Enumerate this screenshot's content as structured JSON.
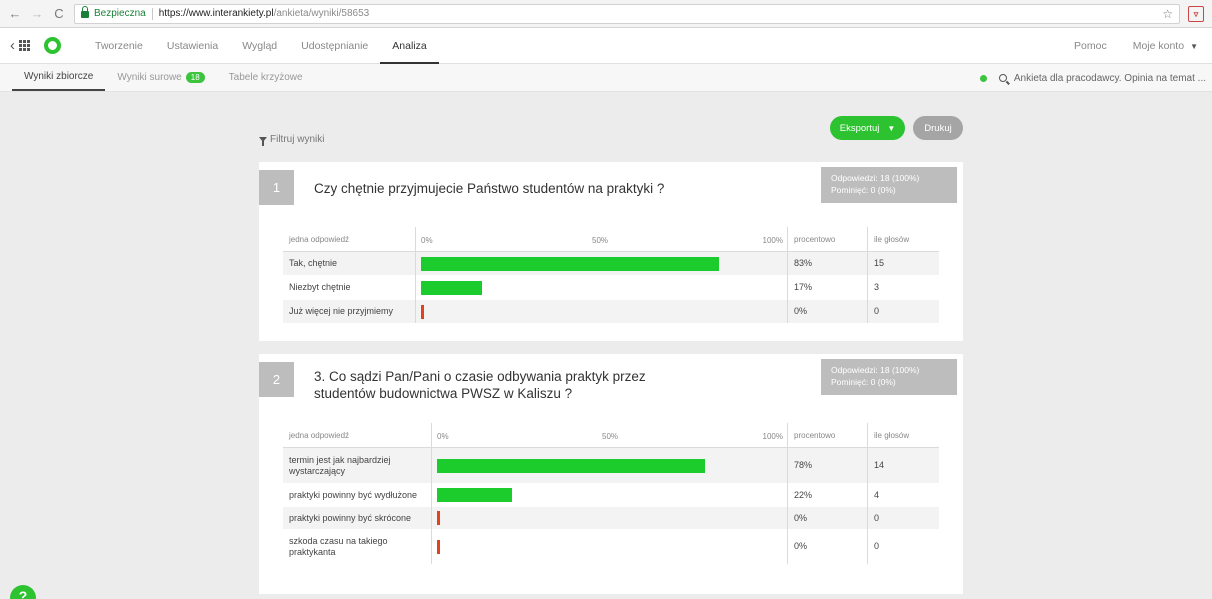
{
  "browser": {
    "secure_label": "Bezpieczna",
    "url_scheme_host": "https://www.interankiety.pl",
    "url_path": "/ankieta/wyniki/58653"
  },
  "app": {
    "tabs": [
      {
        "label": "Tworzenie"
      },
      {
        "label": "Ustawienia"
      },
      {
        "label": "Wygląd"
      },
      {
        "label": "Udostępnianie"
      },
      {
        "label": "Analiza"
      }
    ],
    "help_label": "Pomoc",
    "account_label": "Moje konto"
  },
  "subnav": {
    "tabs": [
      {
        "label": "Wyniki zbiorcze"
      },
      {
        "label": "Wyniki surowe",
        "badge": "18"
      },
      {
        "label": "Tabele krzyżowe"
      }
    ],
    "survey_name": "Ankieta dla pracodawcy. Opinia na temat ..."
  },
  "toolbar": {
    "filter_label": "Filtruj wyniki",
    "export_label": "Eksportuj",
    "print_label": "Drukuj"
  },
  "questions": [
    {
      "number": "1",
      "title_lines": [
        "Czy chętnie przyjmujecie Państwo studentów na praktyki ?"
      ],
      "answers_stat": "Odpowiedzi: 18 (100%)",
      "skipped_stat": "Pominięć: 0 (0%)",
      "headers": {
        "answer": "jedna odpowiedź",
        "scale0": "0%",
        "scale50": "50%",
        "scale100": "100%",
        "percent": "procentowo",
        "count": "ile głosów"
      },
      "rows": [
        {
          "label": "Tak, chętnie",
          "percent_text": "83%",
          "value": 83,
          "count": "15"
        },
        {
          "label": "Niezbyt chętnie",
          "percent_text": "17%",
          "value": 17,
          "count": "3"
        },
        {
          "label": "Już więcej nie przyjmiemy",
          "percent_text": "0%",
          "value": 0,
          "count": "0"
        }
      ]
    },
    {
      "number": "2",
      "title_lines": [
        "3. Co sądzi Pan/Pani o czasie odbywania praktyk przez",
        "studentów budownictwa PWSZ w Kaliszu ?"
      ],
      "answers_stat": "Odpowiedzi: 18 (100%)",
      "skipped_stat": "Pominięć: 0 (0%)",
      "headers": {
        "answer": "jedna odpowiedź",
        "scale0": "0%",
        "scale50": "50%",
        "scale100": "100%",
        "percent": "procentowo",
        "count": "ile głosów"
      },
      "rows": [
        {
          "label_lines": [
            "termin jest jak najbardziej",
            "wystarczający"
          ],
          "percent_text": "78%",
          "value": 78,
          "count": "14"
        },
        {
          "label_lines": [
            "praktyki powinny być wydłużone"
          ],
          "percent_text": "22%",
          "value": 22,
          "count": "4"
        },
        {
          "label_lines": [
            "praktyki powinny być skrócone"
          ],
          "percent_text": "0%",
          "value": 0,
          "count": "0"
        },
        {
          "label_lines": [
            "szkoda czasu na takiego",
            "praktykanta"
          ],
          "percent_text": "0%",
          "value": 0,
          "count": "0"
        }
      ]
    }
  ],
  "colors": {
    "accent": "#2cc230",
    "bar": "#1ccc2c",
    "zero_bar": "#e2411d",
    "stat_box": "#bdbdbd"
  },
  "icons": [
    "back-arrow-icon",
    "forward-arrow-icon",
    "reload-icon",
    "lock-icon",
    "star-icon",
    "extension-icon",
    "chevron-left-icon",
    "apps-grid-icon",
    "logo-ring-icon",
    "caret-down-icon",
    "status-dot-icon",
    "search-icon",
    "filter-funnel-icon",
    "help-icon"
  ]
}
